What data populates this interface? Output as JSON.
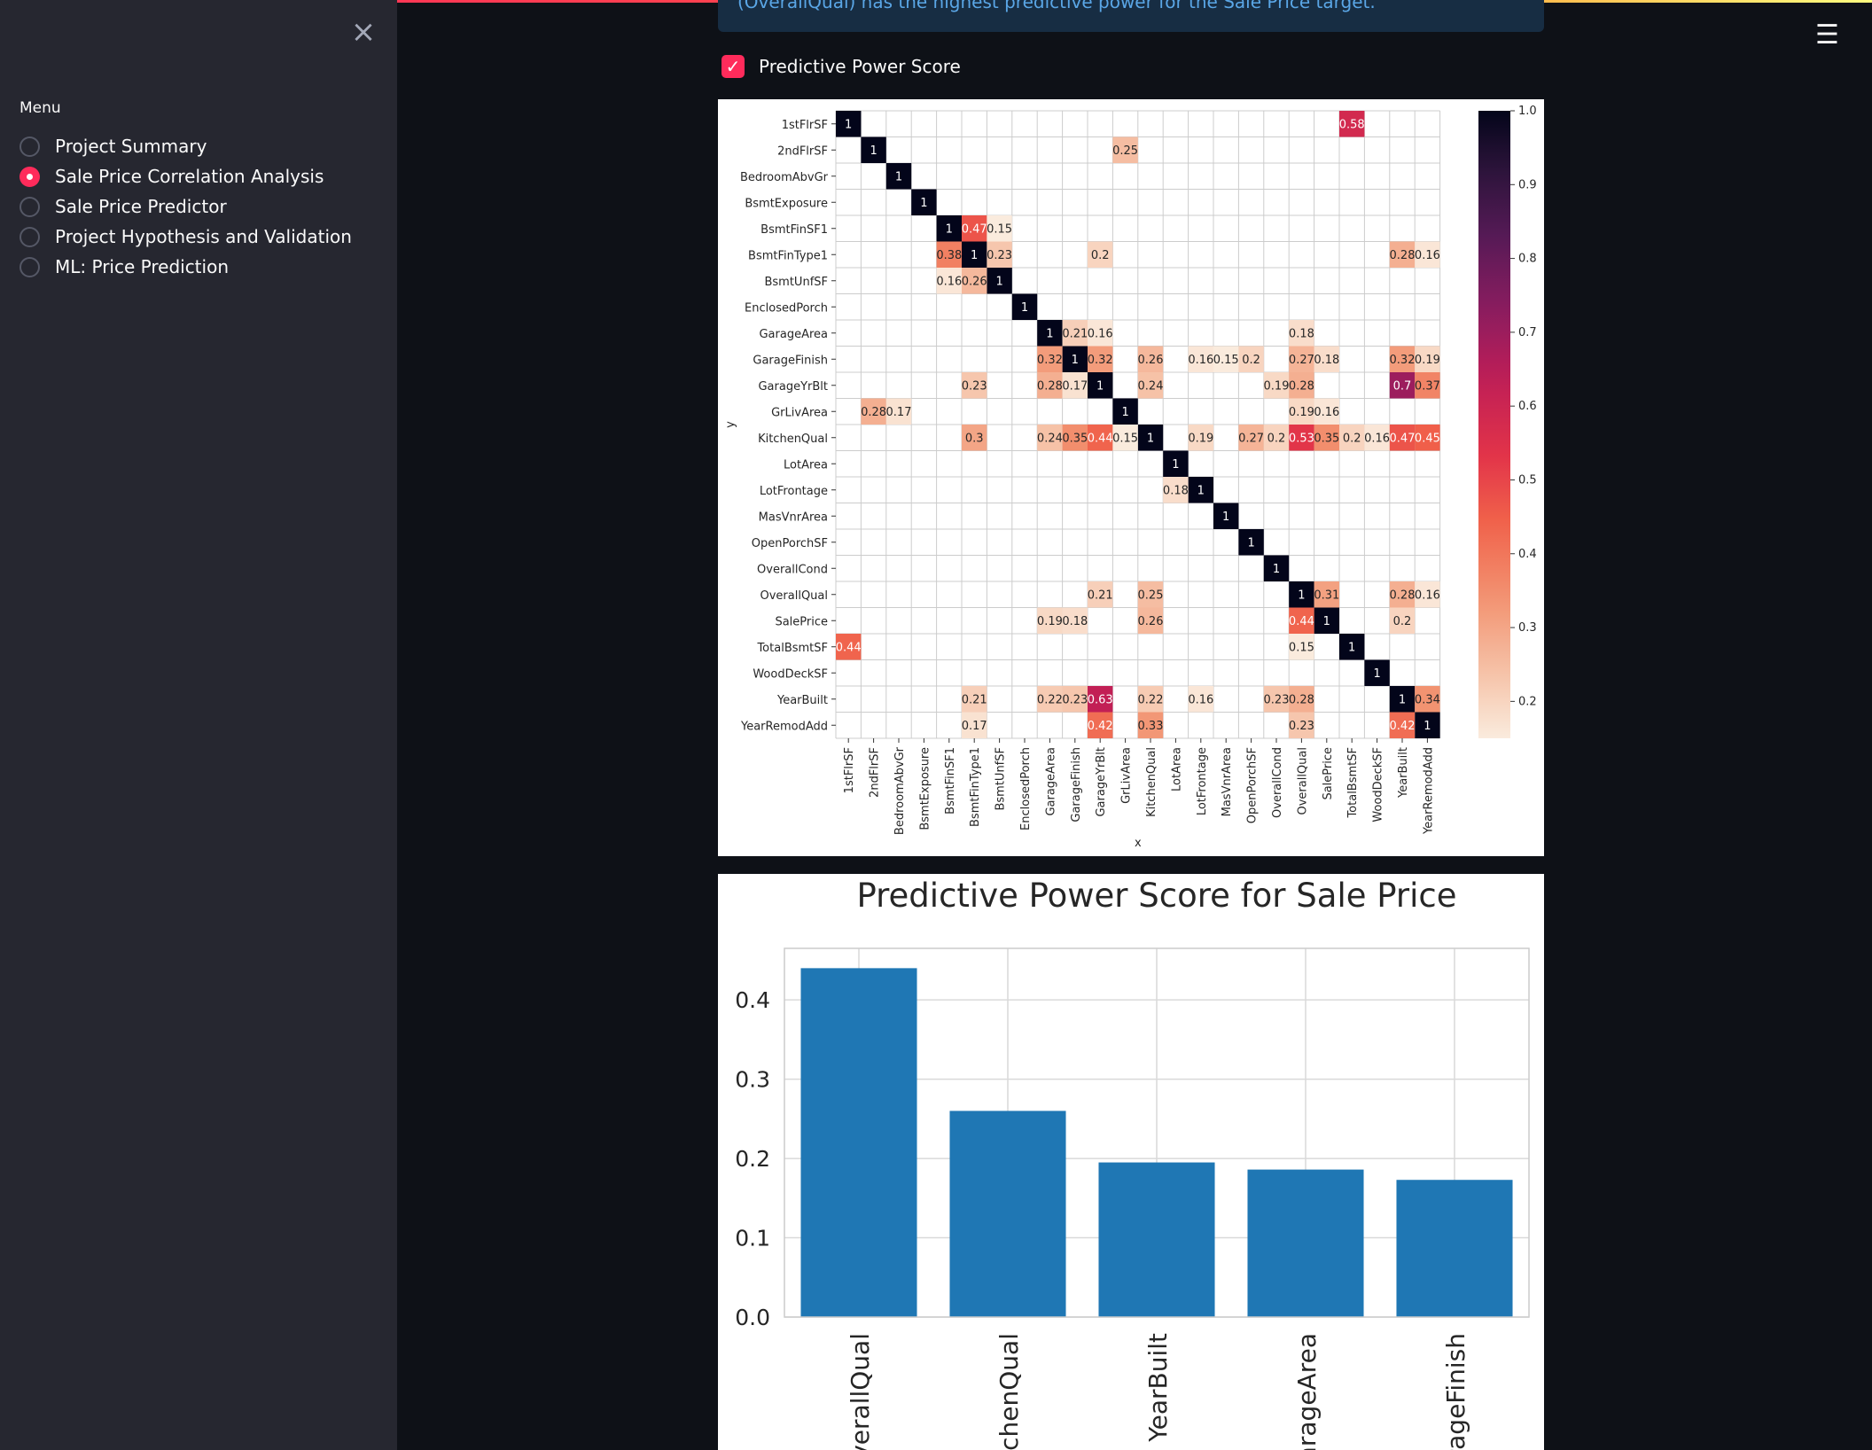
{
  "sidebar": {
    "close_icon": "close-icon",
    "menu_title": "Menu",
    "selected_index": 1,
    "items": [
      {
        "label": "Project Summary"
      },
      {
        "label": "Sale Price Correlation Analysis"
      },
      {
        "label": "Sale Price Predictor"
      },
      {
        "label": "Project Hypothesis and Validation"
      },
      {
        "label": "ML: Price Prediction"
      }
    ]
  },
  "header": {
    "menu_icon": "hamburger-menu-icon"
  },
  "info_box": {
    "text": "(OverallQual) has the highest predictive power for the Sale Price target."
  },
  "checkbox": {
    "label": "Predictive Power Score",
    "checked": true
  },
  "colors": {
    "accent": "#ff2b5b",
    "bar": "#1f77b4",
    "sidebar_bg": "#262730",
    "app_bg": "#0e1117",
    "info_bg": "#172d43",
    "info_text": "#5aa6e6"
  },
  "chart_data": [
    {
      "type": "heatmap",
      "xlabel": "x",
      "ylabel": "y",
      "colorbar_ticks": [
        "1.0",
        "0.9",
        "0.8",
        "0.7",
        "0.6",
        "0.5",
        "0.4",
        "0.3",
        "0.2"
      ],
      "colorbar_range": [
        0.15,
        1.0
      ],
      "annotation_threshold": 0.15,
      "labels": [
        "1stFlrSF",
        "2ndFlrSF",
        "BedroomAbvGr",
        "BsmtExposure",
        "BsmtFinSF1",
        "BsmtFinType1",
        "BsmtUnfSF",
        "EnclosedPorch",
        "GarageArea",
        "GarageFinish",
        "GarageYrBlt",
        "GrLivArea",
        "KitchenQual",
        "LotArea",
        "LotFrontage",
        "MasVnrArea",
        "OpenPorchSF",
        "OverallCond",
        "OverallQual",
        "SalePrice",
        "TotalBsmtSF",
        "WoodDeckSF",
        "YearBuilt",
        "YearRemodAdd"
      ],
      "cells": [
        {
          "y": "1stFlrSF",
          "x": "TotalBsmtSF",
          "v": 0.58
        },
        {
          "y": "2ndFlrSF",
          "x": "GrLivArea",
          "v": 0.25
        },
        {
          "y": "BsmtFinSF1",
          "x": "BsmtFinType1",
          "v": 0.47
        },
        {
          "y": "BsmtFinSF1",
          "x": "BsmtUnfSF",
          "v": 0.15
        },
        {
          "y": "BsmtFinType1",
          "x": "BsmtFinSF1",
          "v": 0.38
        },
        {
          "y": "BsmtFinType1",
          "x": "BsmtUnfSF",
          "v": 0.23
        },
        {
          "y": "BsmtFinType1",
          "x": "GarageYrBlt",
          "v": 0.2
        },
        {
          "y": "BsmtFinType1",
          "x": "YearBuilt",
          "v": 0.28
        },
        {
          "y": "BsmtFinType1",
          "x": "YearRemodAdd",
          "v": 0.16
        },
        {
          "y": "BsmtUnfSF",
          "x": "BsmtFinSF1",
          "v": 0.16
        },
        {
          "y": "BsmtUnfSF",
          "x": "BsmtFinType1",
          "v": 0.26
        },
        {
          "y": "GarageArea",
          "x": "GarageFinish",
          "v": 0.21
        },
        {
          "y": "GarageArea",
          "x": "GarageYrBlt",
          "v": 0.16
        },
        {
          "y": "GarageArea",
          "x": "OverallQual",
          "v": 0.18
        },
        {
          "y": "GarageFinish",
          "x": "GarageArea",
          "v": 0.32
        },
        {
          "y": "GarageFinish",
          "x": "GarageYrBlt",
          "v": 0.32
        },
        {
          "y": "GarageFinish",
          "x": "KitchenQual",
          "v": 0.26
        },
        {
          "y": "GarageFinish",
          "x": "LotFrontage",
          "v": 0.16
        },
        {
          "y": "GarageFinish",
          "x": "MasVnrArea",
          "v": 0.15
        },
        {
          "y": "GarageFinish",
          "x": "OpenPorchSF",
          "v": 0.2
        },
        {
          "y": "GarageFinish",
          "x": "OverallQual",
          "v": 0.27
        },
        {
          "y": "GarageFinish",
          "x": "SalePrice",
          "v": 0.18
        },
        {
          "y": "GarageFinish",
          "x": "YearBuilt",
          "v": 0.32
        },
        {
          "y": "GarageFinish",
          "x": "YearRemodAdd",
          "v": 0.19
        },
        {
          "y": "GarageYrBlt",
          "x": "BsmtFinType1",
          "v": 0.23
        },
        {
          "y": "GarageYrBlt",
          "x": "GarageArea",
          "v": 0.28
        },
        {
          "y": "GarageYrBlt",
          "x": "GarageFinish",
          "v": 0.17
        },
        {
          "y": "GarageYrBlt",
          "x": "KitchenQual",
          "v": 0.24
        },
        {
          "y": "GarageYrBlt",
          "x": "OverallCond",
          "v": 0.19
        },
        {
          "y": "GarageYrBlt",
          "x": "OverallQual",
          "v": 0.28
        },
        {
          "y": "GarageYrBlt",
          "x": "YearBuilt",
          "v": 0.7
        },
        {
          "y": "GarageYrBlt",
          "x": "YearRemodAdd",
          "v": 0.37
        },
        {
          "y": "GrLivArea",
          "x": "2ndFlrSF",
          "v": 0.28
        },
        {
          "y": "GrLivArea",
          "x": "BedroomAbvGr",
          "v": 0.17
        },
        {
          "y": "GrLivArea",
          "x": "OverallQual",
          "v": 0.19
        },
        {
          "y": "GrLivArea",
          "x": "SalePrice",
          "v": 0.16
        },
        {
          "y": "KitchenQual",
          "x": "BsmtFinType1",
          "v": 0.3
        },
        {
          "y": "KitchenQual",
          "x": "GarageArea",
          "v": 0.24
        },
        {
          "y": "KitchenQual",
          "x": "GarageFinish",
          "v": 0.35
        },
        {
          "y": "KitchenQual",
          "x": "GarageYrBlt",
          "v": 0.44
        },
        {
          "y": "KitchenQual",
          "x": "GrLivArea",
          "v": 0.15
        },
        {
          "y": "KitchenQual",
          "x": "LotFrontage",
          "v": 0.19
        },
        {
          "y": "KitchenQual",
          "x": "OpenPorchSF",
          "v": 0.27
        },
        {
          "y": "KitchenQual",
          "x": "OverallCond",
          "v": 0.2
        },
        {
          "y": "KitchenQual",
          "x": "OverallQual",
          "v": 0.53
        },
        {
          "y": "KitchenQual",
          "x": "SalePrice",
          "v": 0.35
        },
        {
          "y": "KitchenQual",
          "x": "TotalBsmtSF",
          "v": 0.2
        },
        {
          "y": "KitchenQual",
          "x": "WoodDeckSF",
          "v": 0.16
        },
        {
          "y": "KitchenQual",
          "x": "YearBuilt",
          "v": 0.47
        },
        {
          "y": "KitchenQual",
          "x": "YearRemodAdd",
          "v": 0.45
        },
        {
          "y": "LotFrontage",
          "x": "LotArea",
          "v": 0.18
        },
        {
          "y": "OverallQual",
          "x": "GarageYrBlt",
          "v": 0.21
        },
        {
          "y": "OverallQual",
          "x": "KitchenQual",
          "v": 0.25
        },
        {
          "y": "OverallQual",
          "x": "SalePrice",
          "v": 0.31
        },
        {
          "y": "OverallQual",
          "x": "YearBuilt",
          "v": 0.28
        },
        {
          "y": "OverallQual",
          "x": "YearRemodAdd",
          "v": 0.16
        },
        {
          "y": "SalePrice",
          "x": "GarageArea",
          "v": 0.19
        },
        {
          "y": "SalePrice",
          "x": "GarageFinish",
          "v": 0.18
        },
        {
          "y": "SalePrice",
          "x": "KitchenQual",
          "v": 0.26
        },
        {
          "y": "SalePrice",
          "x": "OverallQual",
          "v": 0.44
        },
        {
          "y": "SalePrice",
          "x": "YearBuilt",
          "v": 0.2
        },
        {
          "y": "TotalBsmtSF",
          "x": "1stFlrSF",
          "v": 0.44
        },
        {
          "y": "TotalBsmtSF",
          "x": "OverallQual",
          "v": 0.15
        },
        {
          "y": "YearBuilt",
          "x": "BsmtFinType1",
          "v": 0.21
        },
        {
          "y": "YearBuilt",
          "x": "GarageArea",
          "v": 0.22
        },
        {
          "y": "YearBuilt",
          "x": "GarageFinish",
          "v": 0.23
        },
        {
          "y": "YearBuilt",
          "x": "GarageYrBlt",
          "v": 0.63
        },
        {
          "y": "YearBuilt",
          "x": "KitchenQual",
          "v": 0.22
        },
        {
          "y": "YearBuilt",
          "x": "LotFrontage",
          "v": 0.16
        },
        {
          "y": "YearBuilt",
          "x": "OverallCond",
          "v": 0.23
        },
        {
          "y": "YearBuilt",
          "x": "OverallQual",
          "v": 0.28
        },
        {
          "y": "YearBuilt",
          "x": "YearRemodAdd",
          "v": 0.34
        },
        {
          "y": "YearRemodAdd",
          "x": "BsmtFinType1",
          "v": 0.17
        },
        {
          "y": "YearRemodAdd",
          "x": "GarageYrBlt",
          "v": 0.42
        },
        {
          "y": "YearRemodAdd",
          "x": "KitchenQual",
          "v": 0.33
        },
        {
          "y": "YearRemodAdd",
          "x": "OverallQual",
          "v": 0.23
        },
        {
          "y": "YearRemodAdd",
          "x": "YearBuilt",
          "v": 0.42
        }
      ]
    },
    {
      "type": "bar",
      "title": "Predictive Power Score for Sale Price",
      "categories": [
        "OverallQual",
        "KitchenQual",
        "YearBuilt",
        "GarageArea",
        "GarageFinish"
      ],
      "values": [
        0.44,
        0.26,
        0.195,
        0.186,
        0.173
      ],
      "ylim": [
        0,
        0.465
      ],
      "yticks": [
        "0.0",
        "0.1",
        "0.2",
        "0.3",
        "0.4"
      ],
      "grid": true
    }
  ]
}
